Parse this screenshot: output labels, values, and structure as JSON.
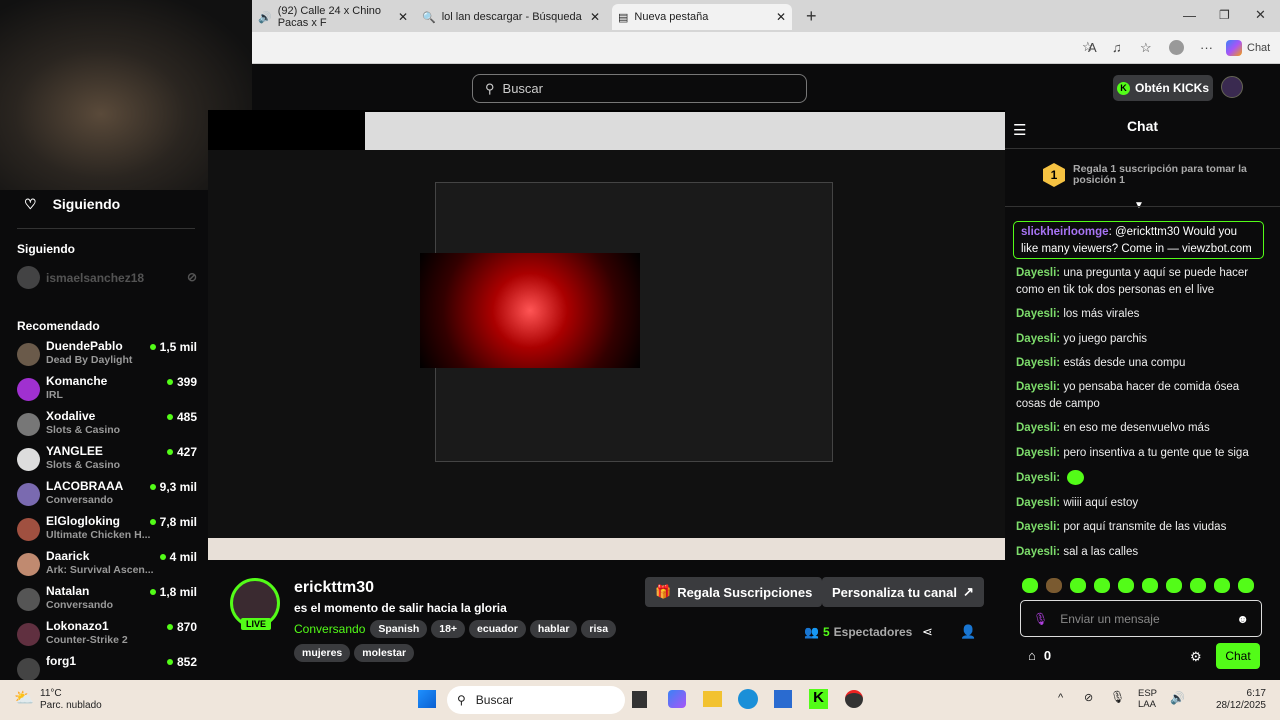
{
  "browser": {
    "tabs": [
      {
        "title": "(92) Calle 24 x Chino Pacas x F"
      },
      {
        "title": "lol lan descargar - Búsqueda"
      },
      {
        "title": "Nueva pestaña"
      }
    ],
    "chat_label": "Chat"
  },
  "header": {
    "search_placeholder": "Buscar",
    "kicks_label": "Obtén KICKs"
  },
  "sidebar": {
    "following_header": "Siguiendo",
    "following_section": "Siguiendo",
    "followed": [
      {
        "name": "ismaelsanchez18"
      }
    ],
    "recommended_section": "Recomendado",
    "recommended": [
      {
        "name": "DuendePablo",
        "category": "Dead By Daylight",
        "viewers": "1,5 mil",
        "color": "#6a5a4a"
      },
      {
        "name": "Komanche",
        "category": "IRL",
        "viewers": "399",
        "color": "#a030d0"
      },
      {
        "name": "Xodalive",
        "category": "Slots & Casino",
        "viewers": "485",
        "color": "#777"
      },
      {
        "name": "YANGLEE",
        "category": "Slots & Casino",
        "viewers": "427",
        "color": "#ddd"
      },
      {
        "name": "LACOBRAAA",
        "category": "Conversando",
        "viewers": "9,3 mil",
        "color": "#7a6ab0"
      },
      {
        "name": "ElGlogloking",
        "category": "Ultimate Chicken H...",
        "viewers": "7,8 mil",
        "color": "#a05040"
      },
      {
        "name": "Daarick",
        "category": "Ark: Survival Ascen...",
        "viewers": "4 mil",
        "color": "#c08a70"
      },
      {
        "name": "Natalan",
        "category": "Conversando",
        "viewers": "1,8 mil",
        "color": "#555"
      },
      {
        "name": "Lokonazo1",
        "category": "Counter-Strike 2",
        "viewers": "870",
        "color": "#603040"
      },
      {
        "name": "forg1",
        "category": "",
        "viewers": "852",
        "color": "#444"
      }
    ]
  },
  "stream": {
    "channel": "erickttm30",
    "title": "es el momento de salir hacia la gloria",
    "live_badge": "LIVE",
    "category": "Conversando",
    "tags": [
      "Spanish",
      "18+",
      "ecuador",
      "hablar",
      "risa",
      "mujeres",
      "molestar"
    ],
    "gift_button": "Regala Suscripciones",
    "customize_button": "Personaliza tu canal",
    "viewers_count": "5",
    "viewers_label": "Espectadores"
  },
  "chat": {
    "title": "Chat",
    "leaderboard_rank": "1",
    "leaderboard_text": "Regala 1 suscripción para tomar la posición 1",
    "pinned": {
      "user": "slickheirloomge",
      "text": "@erickttm30 Would you like many viewers? Come in — viewzbot.com"
    },
    "messages": [
      {
        "user": "Dayesli",
        "text": "una pregunta y aquí se puede hacer como en tik tok dos personas en el live"
      },
      {
        "user": "Dayesli",
        "text": "los más virales"
      },
      {
        "user": "Dayesli",
        "text": "yo juego parchis"
      },
      {
        "user": "Dayesli",
        "text": "estás desde una compu"
      },
      {
        "user": "Dayesli",
        "text": "yo pensaba hacer de comida ósea cosas de campo"
      },
      {
        "user": "Dayesli",
        "text": "en eso me desenvuelvo más"
      },
      {
        "user": "Dayesli",
        "text": "pero insentiva a tu gente que te siga"
      },
      {
        "user": "Dayesli",
        "text": ""
      },
      {
        "user": "Dayesli",
        "text": "wiiii aquí estoy"
      },
      {
        "user": "Dayesli",
        "text": "por aquí transmite de las viudas"
      },
      {
        "user": "Dayesli",
        "text": "sal a las calles"
      }
    ],
    "input_placeholder": "Enviar un mensaje",
    "points": "0",
    "send_label": "Chat",
    "accent": "#53fc18"
  },
  "taskbar": {
    "weather_temp": "11°C",
    "weather_desc": "Parc. nublado",
    "search_label": "Buscar",
    "lang": "ESP",
    "lang2": "LAA",
    "time": "6:17",
    "date": "28/12/2025"
  }
}
